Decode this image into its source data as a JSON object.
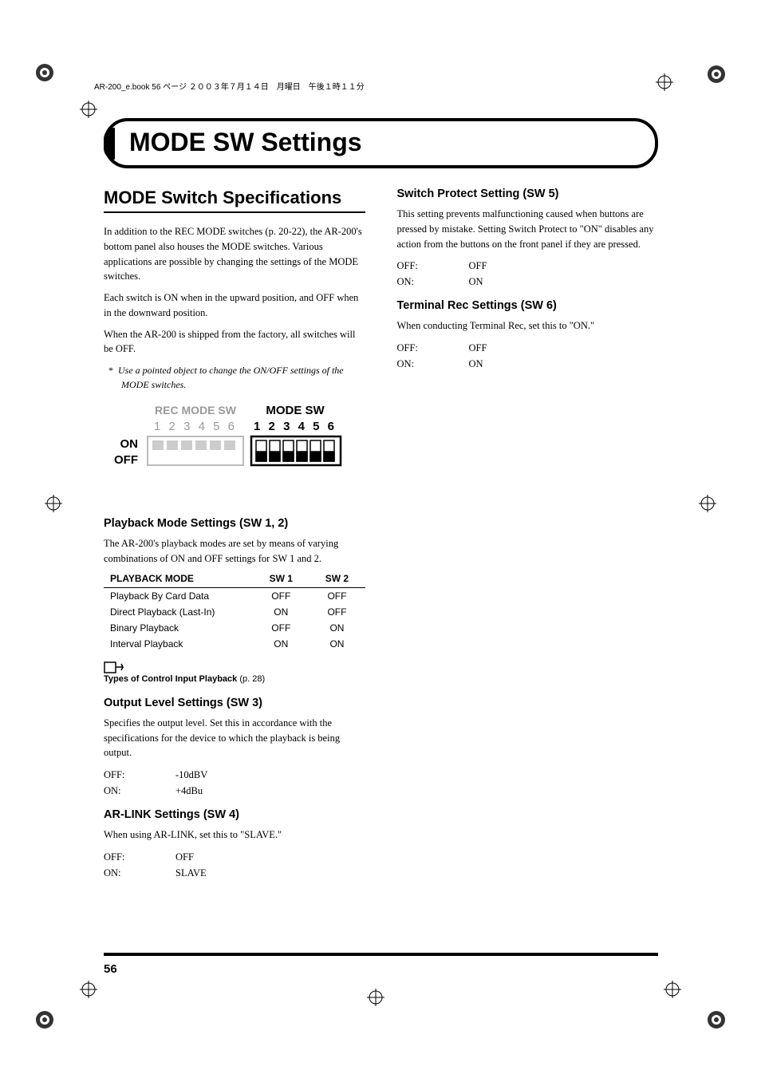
{
  "header_line": "AR-200_e.book  56 ページ  ２００３年７月１４日　月曜日　午後１時１１分",
  "main_title": "MODE SW Settings",
  "left_col": {
    "section_title": "MODE Switch Specifications",
    "para1": "In addition to the REC MODE switches (p. 20-22), the AR-200's bottom panel also houses the MODE switches. Various applications are possible by changing the settings of the MODE switches.",
    "para2": "Each switch is ON when in the upward position, and OFF when in the downward position.",
    "para3": "When the AR-200 is shipped from the factory, all switches will be OFF.",
    "note": "Use a pointed object to change the ON/OFF settings of the MODE switches.",
    "diagram": {
      "rec_mode_label": "REC MODE SW",
      "mode_label": "MODE SW",
      "numbers": "1 2 3 4 5 6",
      "on_label": "ON",
      "off_label": "OFF"
    },
    "playback": {
      "title": "Playback Mode Settings (SW 1, 2)",
      "intro": "The AR-200's playback modes are set by means of varying combinations of ON and OFF settings for SW 1 and 2.",
      "th_mode": "PLAYBACK MODE",
      "th_sw1": "SW 1",
      "th_sw2": "SW 2",
      "rows": [
        {
          "mode": "Playback By Card Data",
          "sw1": "OFF",
          "sw2": "OFF"
        },
        {
          "mode": "Direct Playback (Last-In)",
          "sw1": "ON",
          "sw2": "OFF"
        },
        {
          "mode": "Binary Playback",
          "sw1": "OFF",
          "sw2": "ON"
        },
        {
          "mode": "Interval Playback",
          "sw1": "ON",
          "sw2": "ON"
        }
      ],
      "ref_text": "Types of Control Input Playback",
      "ref_page": "(p. 28)"
    },
    "output_level": {
      "title": "Output Level Settings (SW 3)",
      "intro": "Specifies the output level. Set this in accordance with the specifications for the device to which the playback is being output.",
      "rows": [
        {
          "k": "OFF:",
          "v": "-10dBV"
        },
        {
          "k": "ON:",
          "v": "+4dBu"
        }
      ]
    },
    "arlink": {
      "title": "AR-LINK Settings (SW 4)",
      "intro": "When using AR-LINK, set this to \"SLAVE.\"",
      "rows": [
        {
          "k": "OFF:",
          "v": "OFF"
        },
        {
          "k": "ON:",
          "v": "SLAVE"
        }
      ]
    }
  },
  "right_col": {
    "switch_protect": {
      "title": "Switch Protect Setting (SW 5)",
      "intro": "This setting prevents malfunctioning caused when buttons are pressed by mistake. Setting Switch Protect to \"ON\" disables any action from the buttons on the front panel if they are pressed.",
      "rows": [
        {
          "k": "OFF:",
          "v": "OFF"
        },
        {
          "k": "ON:",
          "v": "ON"
        }
      ]
    },
    "terminal_rec": {
      "title": "Terminal Rec Settings (SW 6)",
      "intro": "When conducting Terminal Rec, set this to \"ON.\"",
      "rows": [
        {
          "k": "OFF:",
          "v": "OFF"
        },
        {
          "k": "ON:",
          "v": "ON"
        }
      ]
    }
  },
  "page_number": "56"
}
